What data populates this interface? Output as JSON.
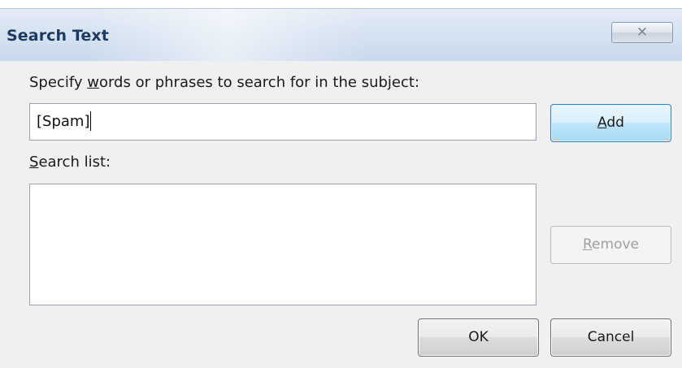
{
  "dialog": {
    "title": "Search Text",
    "close_icon": "close-icon",
    "close_glyph": "✕"
  },
  "form": {
    "words_label_prefix": "Specify ",
    "words_label_access": "w",
    "words_label_suffix": "ords or phrases to search for in the subject:",
    "search_value": "[Spam]",
    "search_list_label_access": "S",
    "search_list_label_suffix": "earch list:",
    "search_list_items": []
  },
  "buttons": {
    "add_access": "A",
    "add_suffix": "dd",
    "remove_access": "R",
    "remove_suffix": "emove",
    "ok_label": "OK",
    "cancel_label": "Cancel"
  },
  "colors": {
    "title_text": "#1e3a63",
    "title_bar": "#d6e3f2",
    "dialog_bg": "#f0f0f0",
    "add_button_accent": "#bee6fd",
    "disabled_text": "#a0a0a0"
  }
}
